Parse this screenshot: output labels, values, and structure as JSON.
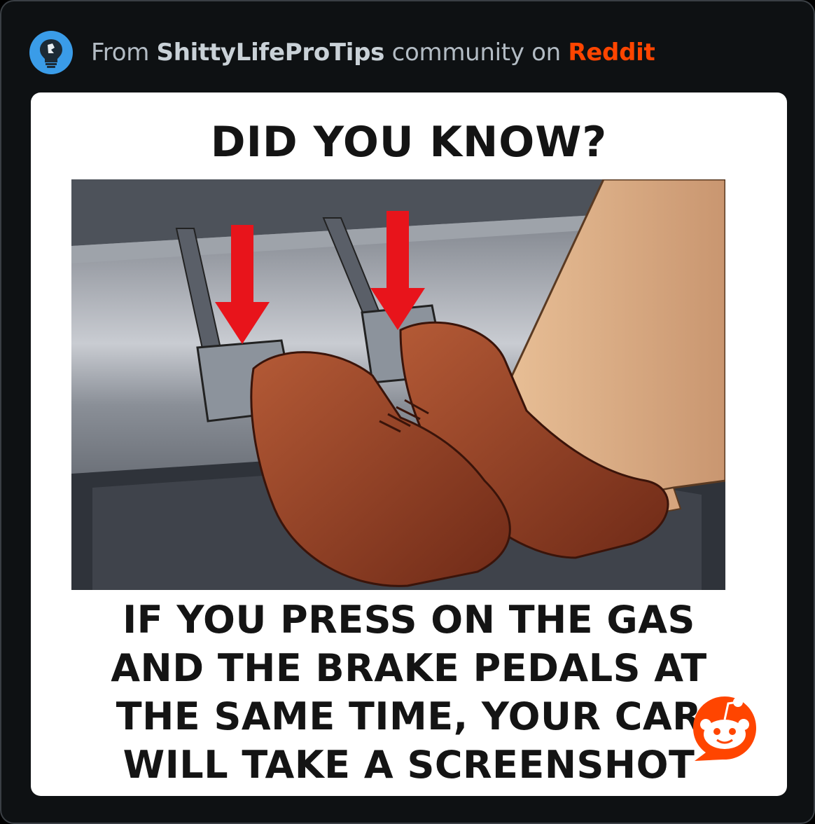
{
  "header": {
    "prefix": "From ",
    "community": "ShittyLifeProTips",
    "middle": " community on ",
    "platform": "Reddit",
    "avatar_icon": "lightbulb-icon"
  },
  "post": {
    "title": "DID YOU KNOW?",
    "caption_lines": [
      "IF YOU PRESS ON THE GAS",
      "AND THE BRAKE PEDALS AT",
      "THE SAME TIME, YOUR CAR",
      "WILL TAKE A SCREENSHOT"
    ],
    "illustration_icon": "car-pedals-illustration",
    "badge_icon": "reddit-snoo-icon"
  },
  "colors": {
    "background": "#0e1113",
    "platform_accent": "#ff4500",
    "avatar": "#3a9ce8",
    "arrow": "#e8141b"
  }
}
